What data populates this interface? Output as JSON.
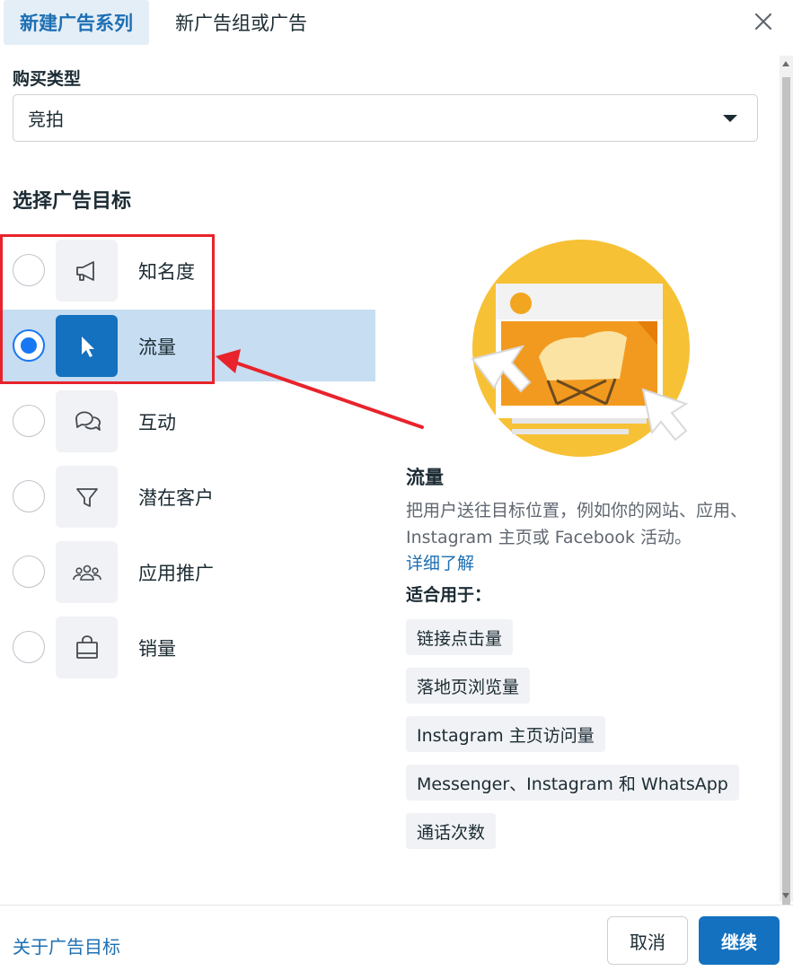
{
  "tabs": {
    "active": "新建广告系列",
    "inactive": "新广告组或广告"
  },
  "buy_type": {
    "label": "购买类型",
    "value": "竞拍"
  },
  "objective_section": {
    "title": "选择广告目标",
    "options": [
      {
        "label": "知名度",
        "icon": "megaphone-icon",
        "selected": false
      },
      {
        "label": "流量",
        "icon": "cursor-icon",
        "selected": true
      },
      {
        "label": "互动",
        "icon": "chat-bubbles-icon",
        "selected": false
      },
      {
        "label": "潜在客户",
        "icon": "funnel-icon",
        "selected": false
      },
      {
        "label": "应用推广",
        "icon": "people-icon",
        "selected": false
      },
      {
        "label": "销量",
        "icon": "shopping-bag-icon",
        "selected": false
      }
    ]
  },
  "detail": {
    "title": "流量",
    "description": "把用户送往目标位置，例如你的网站、应用、Instagram 主页或 Facebook 活动。",
    "link": "详细了解",
    "suited_label": "适合用于：",
    "chips": [
      "链接点击量",
      "落地页浏览量",
      "Instagram 主页访问量",
      "Messenger、Instagram 和 WhatsApp",
      "通话次数"
    ]
  },
  "footer": {
    "link": "关于广告目标",
    "cancel": "取消",
    "continue": "继续"
  },
  "colors": {
    "accent": "#1371c0",
    "selected_row": "#c6ddf2",
    "annotation_red": "#e8232b",
    "illustration_yellow": "#f7c136"
  }
}
